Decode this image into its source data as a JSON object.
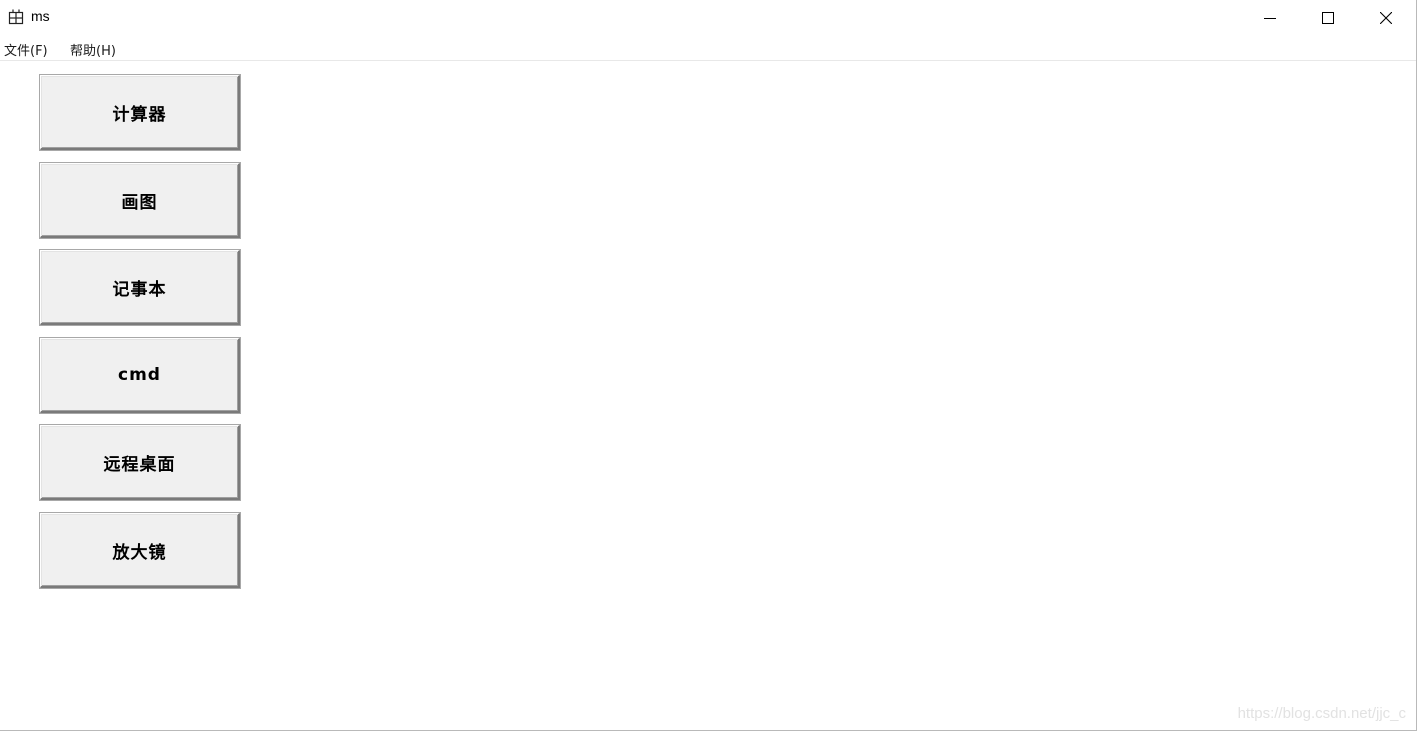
{
  "window": {
    "title": "ms",
    "icon": "app-grid-icon",
    "controls": {
      "minimize_icon": "minimize-icon",
      "maximize_icon": "maximize-icon",
      "close_icon": "close-icon"
    }
  },
  "menubar": {
    "items": [
      {
        "label": "文件(F)"
      },
      {
        "label": "帮助(H)"
      }
    ]
  },
  "buttons": [
    {
      "label": "计算器"
    },
    {
      "label": "画图"
    },
    {
      "label": "记事本"
    },
    {
      "label": "cmd"
    },
    {
      "label": "远程桌面"
    },
    {
      "label": "放大镜"
    }
  ],
  "watermark": "https://blog.csdn.net/jjc_c",
  "colors": {
    "button_face": "#f0f0f0",
    "button_shadow": "#7a7a7a",
    "background": "#ffffff"
  }
}
